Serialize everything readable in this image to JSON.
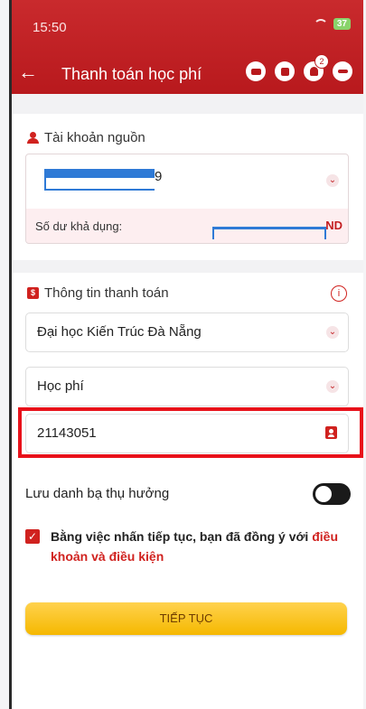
{
  "status": {
    "time": "15:50",
    "battery": "37"
  },
  "header": {
    "title": "Thanh toán học phí",
    "notification_count": "2"
  },
  "source_account": {
    "label": "Tài khoản nguồn",
    "account_suffix": "9",
    "balance_label": "Số dư khả dụng:",
    "balance_suffix": "ND"
  },
  "payment_info": {
    "label": "Thông tin thanh toán",
    "school": "Đại học Kiến Trúc Đà Nẵng",
    "fee_type": "Học phí",
    "student_id": "21143051"
  },
  "save_beneficiary": {
    "label": "Lưu danh bạ thụ hưởng"
  },
  "terms": {
    "text": "Bằng việc nhấn tiếp tục, bạn đã đồng ý với ",
    "link": "điều khoản và điều kiện"
  },
  "actions": {
    "continue_label": "TIẾP TỤC"
  },
  "colors": {
    "brand": "#c31e21",
    "button": "#f5b800"
  }
}
